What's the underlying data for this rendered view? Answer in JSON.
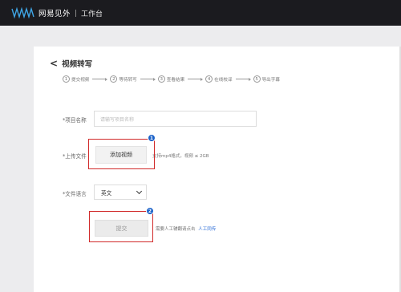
{
  "topbar": {
    "brand": "网易见外",
    "workspace": "工作台"
  },
  "page": {
    "back_symbol": "<",
    "title": "视频转写"
  },
  "steps": [
    {
      "num": "1",
      "label": "提交视频"
    },
    {
      "num": "2",
      "label": "等待转写"
    },
    {
      "num": "3",
      "label": "查看结果"
    },
    {
      "num": "4",
      "label": "在线校译"
    },
    {
      "num": "5",
      "label": "导出字幕"
    }
  ],
  "form": {
    "project_name_label": "*项目名称",
    "project_name_placeholder": "请输写项目名称",
    "upload_label": "*上传文件",
    "add_video_button": "添加视频",
    "upload_hint": "支持mp4格式，视频 ≤ 2GB",
    "language_label": "*文件语言",
    "language_value": "英文",
    "submit_button": "提交",
    "submit_note": "需要人工辅翻请点击",
    "manual_link": "人工同传"
  },
  "annotations": [
    {
      "num": "1"
    },
    {
      "num": "2"
    }
  ],
  "colors": {
    "topbar": "#1b1b1f",
    "highlight": "#d12a2a",
    "badge": "#1c63c9",
    "link": "#2a6bd6"
  },
  "icons": {
    "back": "chevron-left-icon",
    "logo": "wave-logo-icon",
    "select": "chevron-down-icon"
  }
}
